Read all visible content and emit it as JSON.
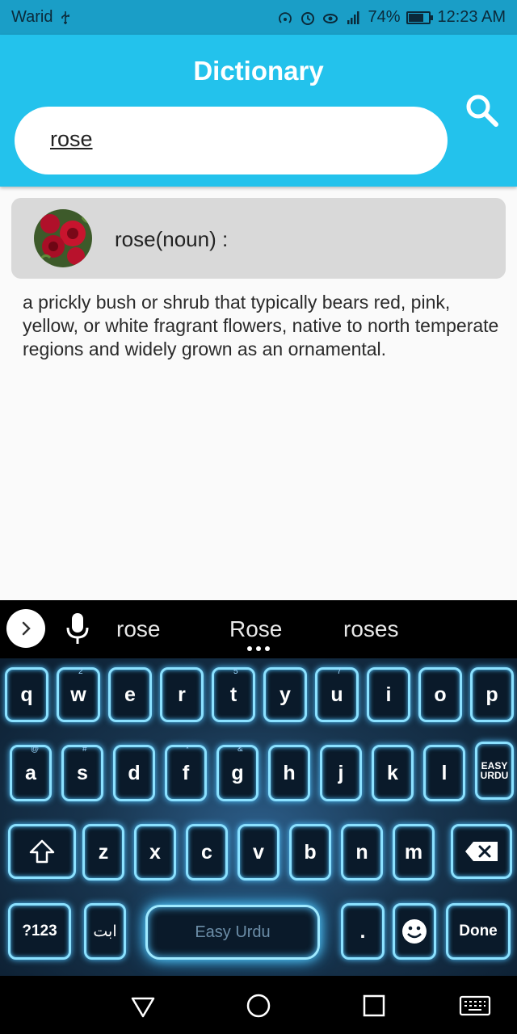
{
  "status_bar": {
    "carrier": "Warid",
    "battery": "74%",
    "battery_level": 0.74,
    "time": "12:23 AM",
    "icons": [
      "usb-icon",
      "hotspot-icon",
      "alarm-icon",
      "eye-icon",
      "4g-icon",
      "signal-icon",
      "battery-icon"
    ]
  },
  "app": {
    "title": "Dictionary",
    "search_value": "rose"
  },
  "result": {
    "word": "rose(noun) :",
    "definition": "a prickly bush or shrub that typically bears red, pink, yellow, or white fragrant flowers, native to north temperate regions and widely grown as an ornamental."
  },
  "keyboard": {
    "suggestions": [
      "rose",
      "Rose",
      "roses"
    ],
    "row1": [
      "q",
      "w",
      "e",
      "r",
      "t",
      "y",
      "u",
      "i",
      "o",
      "p"
    ],
    "row1_hints": [
      "",
      "2",
      "",
      "",
      "5",
      "",
      "7",
      "",
      "",
      ""
    ],
    "row2": [
      "a",
      "s",
      "d",
      "f",
      "g",
      "h",
      "j",
      "k",
      "l"
    ],
    "row2_hints": [
      "@",
      "#",
      "",
      "*",
      "&",
      "",
      "",
      "",
      ""
    ],
    "easy_urdu_key": "EASY URDU",
    "row3": [
      "z",
      "x",
      "c",
      "v",
      "b",
      "n",
      "m"
    ],
    "num_key": "?123",
    "urdu_key": "ابت",
    "space_label": "Easy Urdu",
    "period": ".",
    "done_label": "Done"
  },
  "colors": {
    "app_bar": "#23c2ec",
    "status_bar": "#1a9ec7",
    "card": "#d9d9d9",
    "key_glow": "#8be1ff"
  }
}
